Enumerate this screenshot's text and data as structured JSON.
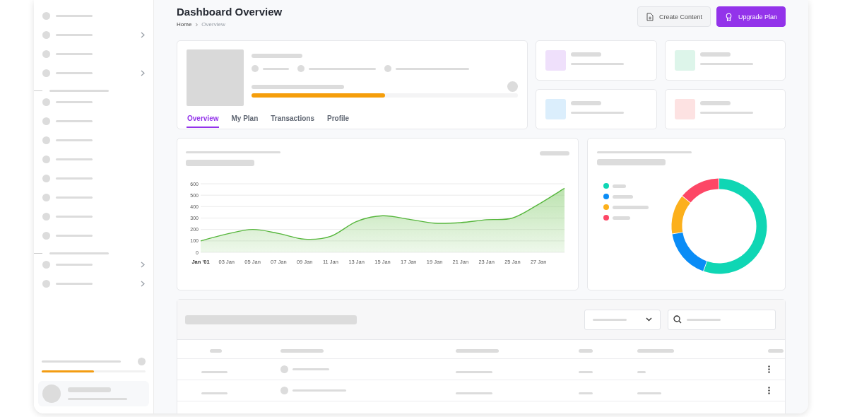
{
  "header": {
    "title": "Dashboard Overview",
    "breadcrumb": [
      {
        "label": "Home",
        "current": false
      },
      {
        "label": "Overview",
        "current": true
      }
    ],
    "buttons": [
      {
        "label": "Create Content",
        "kind": "secondary"
      },
      {
        "label": "Upgrade Plan",
        "kind": "primary"
      }
    ]
  },
  "sidebar": {
    "sections": [
      {
        "items": [
          {
            "expandable": false
          },
          {
            "expandable": true
          },
          {
            "expandable": false
          },
          {
            "expandable": true
          }
        ]
      },
      {
        "items": [
          {
            "expandable": false
          },
          {
            "expandable": false
          },
          {
            "expandable": false
          },
          {
            "expandable": false
          },
          {
            "expandable": false
          },
          {
            "expandable": false
          },
          {
            "expandable": false
          },
          {
            "expandable": false
          }
        ]
      },
      {
        "items": [
          {
            "expandable": true
          },
          {
            "expandable": true
          }
        ]
      }
    ],
    "usage": {
      "level": 0.5
    }
  },
  "profile": {
    "progress": {
      "level": 0.5
    },
    "tabs": [
      {
        "label": "Overview",
        "selected": true
      },
      {
        "label": "My Plan",
        "selected": false
      },
      {
        "label": "Transactions",
        "selected": false
      },
      {
        "label": "Profile",
        "selected": false
      }
    ]
  },
  "stat_cards": [
    {
      "color": "#efe0fb"
    },
    {
      "color": "#ddf5ea"
    },
    {
      "color": "#dbeefc"
    },
    {
      "color": "#fde2e2"
    }
  ],
  "sales_chart": {
    "chart_data": {
      "type": "area",
      "categories": [
        "Jan '01",
        "03 Jan",
        "05 Jan",
        "07 Jan",
        "09 Jan",
        "11 Jan",
        "13 Jan",
        "15 Jan",
        "17 Jan",
        "19 Jan",
        "21 Jan",
        "23 Jan",
        "25 Jan",
        "27 Jan",
        null
      ],
      "values": [
        100,
        160,
        200,
        165,
        115,
        140,
        270,
        320,
        290,
        255,
        260,
        285,
        300,
        420,
        560
      ],
      "grid": true,
      "ylim": [
        0,
        600
      ],
      "yticks": [
        0,
        100,
        200,
        300,
        400,
        500,
        600
      ]
    }
  },
  "breakdown": {
    "legend": [
      {
        "color": "#0fd6b4"
      },
      {
        "color": "#0a8cf6"
      },
      {
        "color": "#fcb01c"
      },
      {
        "color": "#fd4766"
      }
    ]
  }
}
